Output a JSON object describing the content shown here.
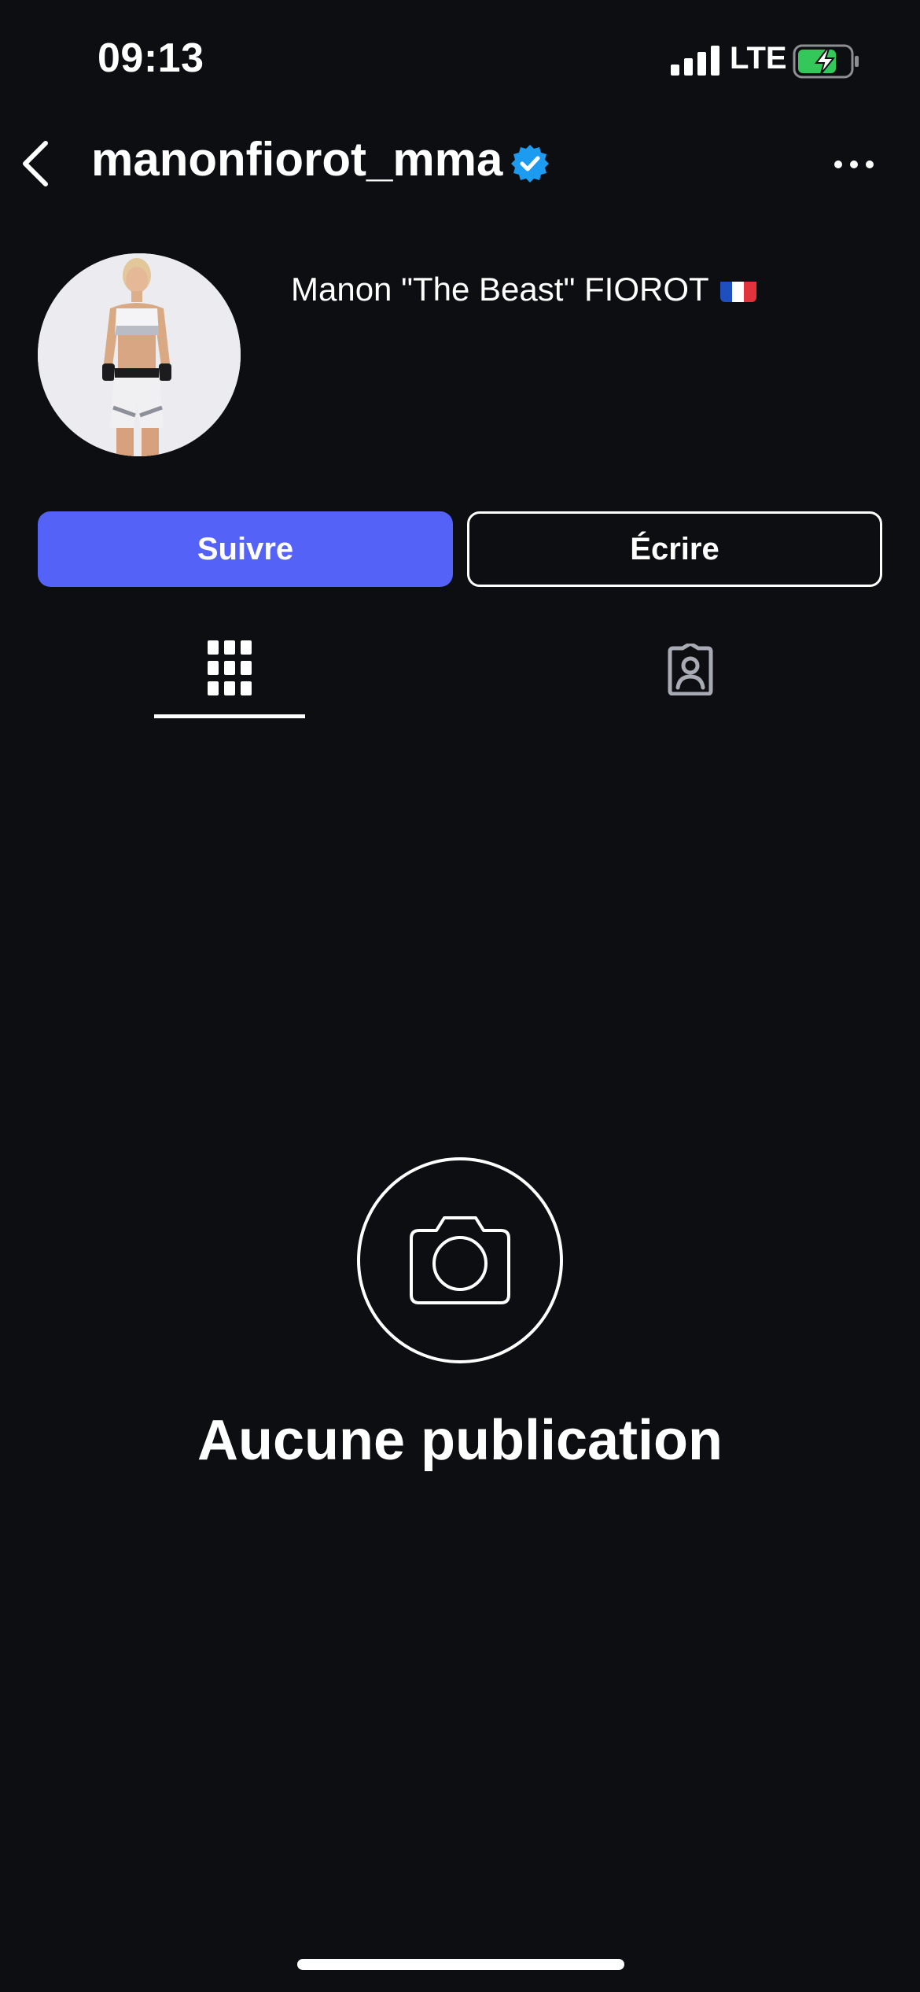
{
  "status_bar": {
    "time": "09:13",
    "network": "LTE",
    "signal_bars": 4,
    "battery_charging": true
  },
  "header": {
    "username": "manonfiorot_mma",
    "verified": true,
    "back_icon": "chevron-left-icon",
    "more_icon": "more-horizontal-icon"
  },
  "profile": {
    "display_name": "Manon \"The Beast\" FIOROT",
    "flag": "france-flag-icon"
  },
  "actions": {
    "follow_label": "Suivre",
    "message_label": "Écrire"
  },
  "tabs": {
    "active": "posts",
    "items": [
      {
        "id": "posts",
        "icon": "grid-icon"
      },
      {
        "id": "tagged",
        "icon": "tagged-person-icon"
      }
    ]
  },
  "empty_state": {
    "icon": "camera-icon",
    "message": "Aucune publication"
  },
  "colors": {
    "background": "#0c0e12",
    "follow_button": "#5462f7",
    "verified_badge": "#1d9bf0",
    "battery_fill": "#34c759"
  }
}
